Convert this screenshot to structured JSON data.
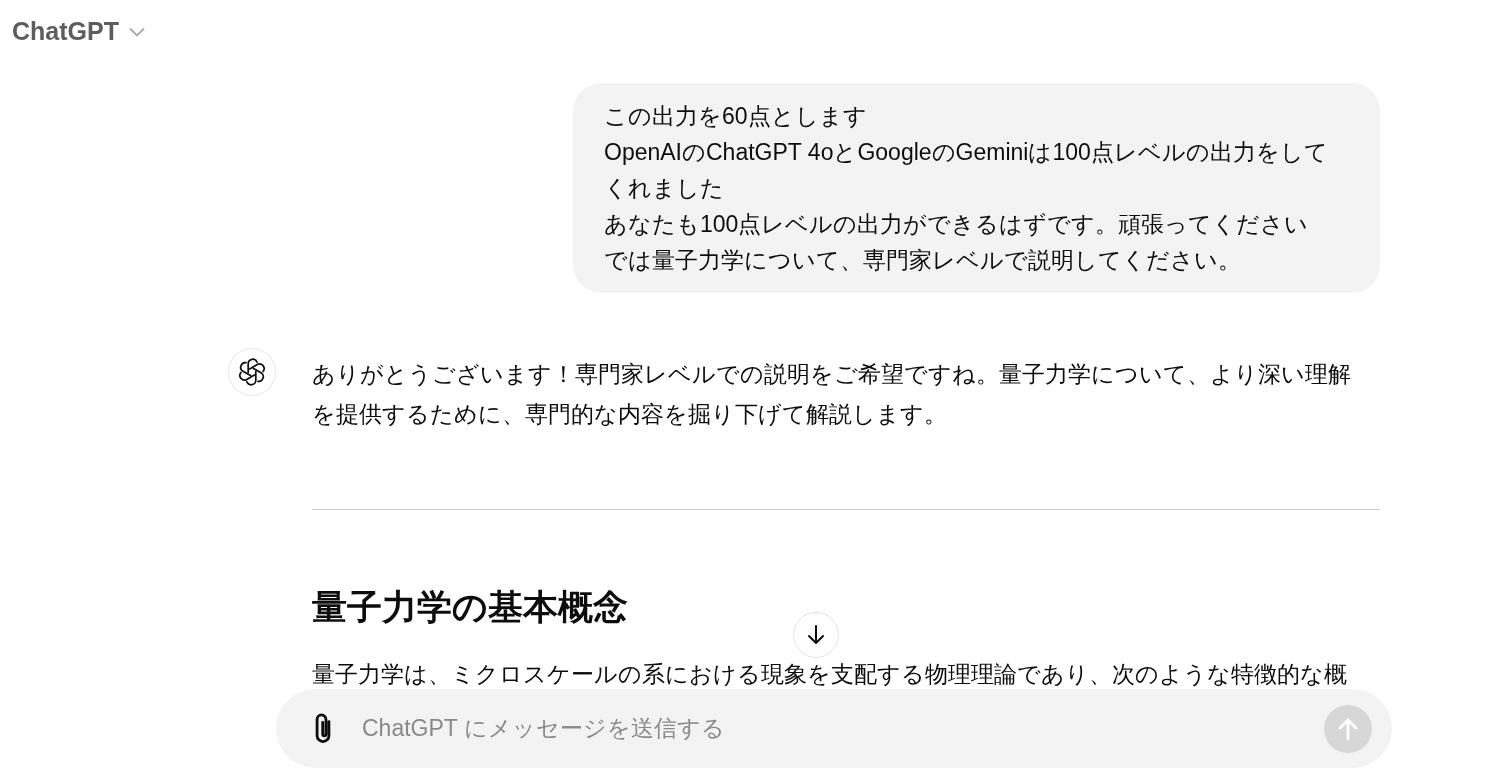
{
  "header": {
    "model_name": "ChatGPT"
  },
  "messages": [
    {
      "kind": "user",
      "lines": [
        "この出力を60点とします",
        "OpenAIのChatGPT 4oとGoogleのGeminiは100点レベルの出力をしてくれました",
        "あなたも100点レベルの出力ができるはずです。頑張ってください",
        "では量子力学について、専門家レベルで説明してください。"
      ]
    },
    {
      "kind": "assistant",
      "blocks": [
        {
          "kind": "paragraph",
          "text": "ありがとうございます！専門家レベルでの説明をご希望ですね。量子力学について、より深い理解を提供するために、専門的な内容を掘り下げて解説します。"
        },
        {
          "kind": "divider"
        },
        {
          "kind": "heading",
          "text": "量子力学の基本概念"
        },
        {
          "kind": "paragraph",
          "text": "量子力学は、ミクロスケールの系における現象を支配する物理理論であり、次のような特徴的な概"
        }
      ]
    }
  ],
  "composer": {
    "placeholder": "ChatGPT にメッセージを送信する",
    "send_disabled": true
  }
}
